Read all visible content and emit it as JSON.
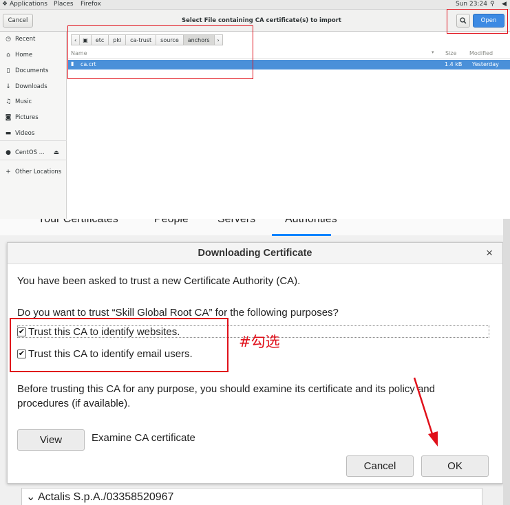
{
  "top_screenshot": {
    "topbar": {
      "applications": "Applications",
      "places": "Places",
      "firefox": "Firefox",
      "clock": "Sun 23:24"
    },
    "header": {
      "cancel_label": "Cancel",
      "title": "Select File containing CA certificate(s) to import",
      "open_label": "Open",
      "search_icon": "search-icon"
    },
    "sidebar": {
      "items": [
        {
          "label": "Recent",
          "icon": "clock-icon"
        },
        {
          "label": "Home",
          "icon": "home-icon"
        },
        {
          "label": "Documents",
          "icon": "document-icon"
        },
        {
          "label": "Downloads",
          "icon": "download-icon"
        },
        {
          "label": "Music",
          "icon": "music-icon"
        },
        {
          "label": "Pictures",
          "icon": "camera-icon"
        },
        {
          "label": "Videos",
          "icon": "video-icon"
        },
        {
          "label": "CentOS ...",
          "icon": "disc-icon"
        },
        {
          "label": "Other Locations",
          "icon": "plus-icon"
        }
      ]
    },
    "pathbar": {
      "crumbs": [
        "etc",
        "pki",
        "ca-trust",
        "source",
        "anchors"
      ]
    },
    "file_list": {
      "columns": {
        "name": "Name",
        "size": "Size",
        "modified": "Modified"
      },
      "rows": [
        {
          "name": "ca.crt",
          "size": "1.4 kB",
          "modified": "Yesterday"
        }
      ]
    }
  },
  "bottom_screenshot": {
    "prefs_tabs": [
      "Your Certificates",
      "People",
      "Servers",
      "Authorities"
    ],
    "dialog": {
      "title": "Downloading Certificate",
      "close": "×",
      "intro": "You have been asked to trust a new Certificate Authority (CA).",
      "question": "Do you want to trust “Skill Global Root CA” for the following purposes?",
      "checkboxes": [
        {
          "label": "Trust this CA to identify websites.",
          "checked": true
        },
        {
          "label": "Trust this CA to identify email users.",
          "checked": true
        }
      ],
      "warning_line1": "Before trusting this CA for any purpose, you should examine its certificate and its policy and",
      "warning_line2": "procedures (if available).",
      "view_label": "View",
      "view_desc": "Examine CA certificate",
      "cancel_label": "Cancel",
      "ok_label": "OK"
    },
    "annotation": "#勾选",
    "list_item": "Actalis S.p.A./03358520967"
  },
  "colors": {
    "highlight_red": "#e0101a",
    "selection_blue": "#4a90d9",
    "open_blue": "#3d8ae3"
  }
}
